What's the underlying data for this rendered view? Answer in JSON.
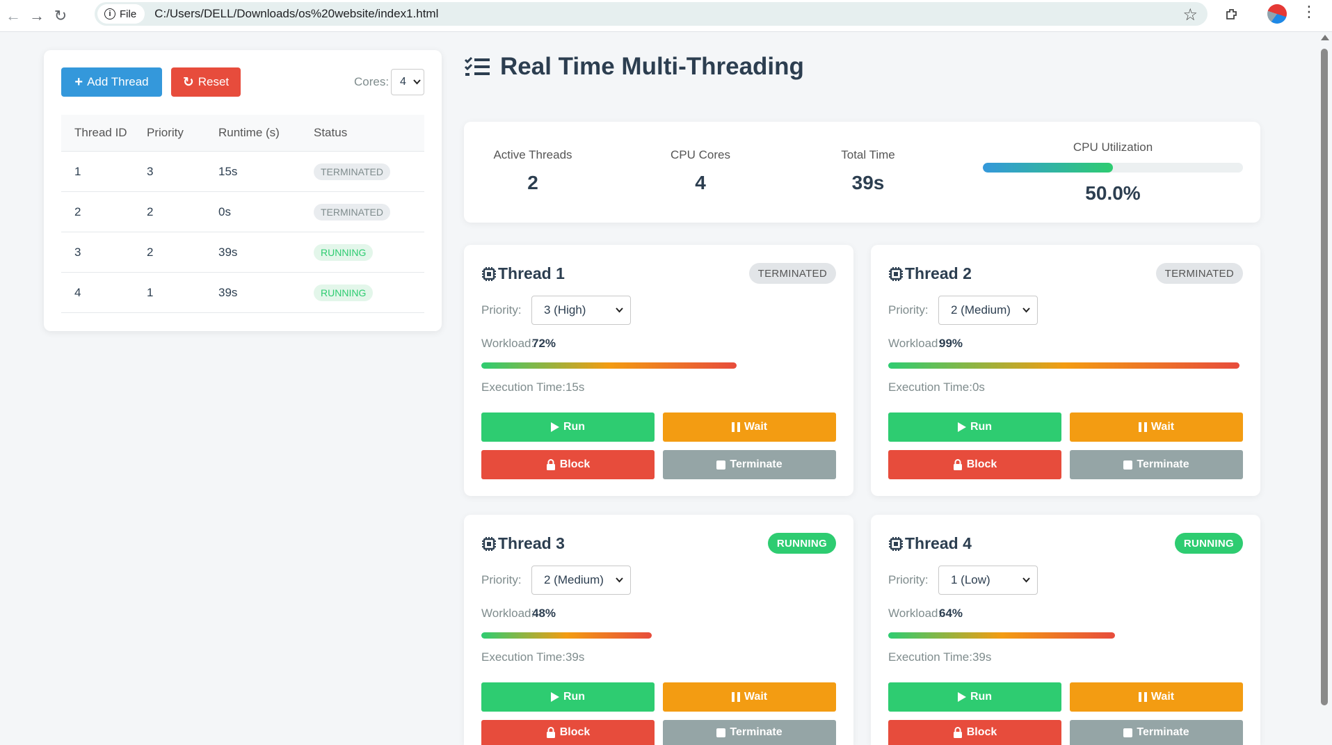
{
  "browser": {
    "site_chip": "File",
    "url": "C:/Users/DELL/Downloads/os%20website/index1.html"
  },
  "controls": {
    "add_thread_label": "Add Thread",
    "reset_label": "Reset",
    "cores_label": "Cores:",
    "cores_value": "4"
  },
  "table": {
    "headers": [
      "Thread ID",
      "Priority",
      "Runtime (s)",
      "Status"
    ],
    "rows": [
      {
        "id": "1",
        "priority": "3",
        "runtime": "15s",
        "status": "TERMINATED"
      },
      {
        "id": "2",
        "priority": "2",
        "runtime": "0s",
        "status": "TERMINATED"
      },
      {
        "id": "3",
        "priority": "2",
        "runtime": "39s",
        "status": "RUNNING"
      },
      {
        "id": "4",
        "priority": "1",
        "runtime": "39s",
        "status": "RUNNING"
      }
    ]
  },
  "header": {
    "title": "Real Time Multi-Threading"
  },
  "stats": {
    "active_threads_label": "Active Threads",
    "active_threads": "2",
    "cpu_cores_label": "CPU Cores",
    "cpu_cores": "4",
    "total_time_label": "Total Time",
    "total_time": "39s",
    "cpu_util_label": "CPU Utilization",
    "cpu_util": "50.0%",
    "cpu_util_fraction": 0.5
  },
  "labels": {
    "priority": "Priority:",
    "workload": "Workload:",
    "run": "Run",
    "wait": "Wait",
    "block": "Block",
    "terminate": "Terminate"
  },
  "threads": [
    {
      "title": "Thread 1",
      "status": "TERMINATED",
      "priority": "3 (High)",
      "workload": "72%",
      "workload_fraction": 0.72,
      "execution": "Execution Time:15s"
    },
    {
      "title": "Thread 2",
      "status": "TERMINATED",
      "priority": "2 (Medium)",
      "workload": "99%",
      "workload_fraction": 0.99,
      "execution": "Execution Time:0s"
    },
    {
      "title": "Thread 3",
      "status": "RUNNING",
      "priority": "2 (Medium)",
      "workload": "48%",
      "workload_fraction": 0.48,
      "execution": "Execution Time:39s"
    },
    {
      "title": "Thread 4",
      "status": "RUNNING",
      "priority": "1 (Low)",
      "workload": "64%",
      "workload_fraction": 0.64,
      "execution": "Execution Time:39s"
    }
  ],
  "colors": {
    "primary": "#3498db",
    "danger": "#e74c3c",
    "success": "#2ecc71",
    "warning": "#f39c12",
    "muted": "#95a5a6"
  }
}
